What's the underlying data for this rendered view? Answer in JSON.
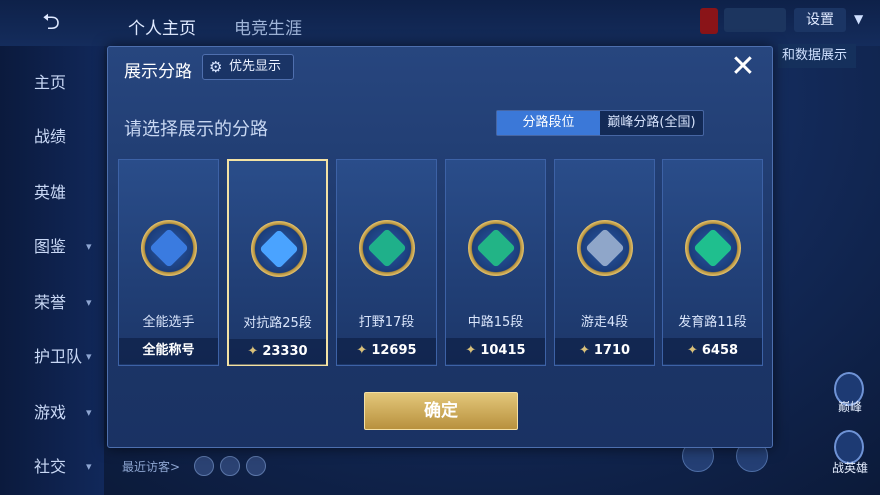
{
  "header": {
    "tabs": [
      "个人主页",
      "电竞生涯"
    ],
    "settings_label": "设置",
    "right_label": "和数据展示"
  },
  "sidebar": {
    "items": [
      {
        "label": "主页",
        "has_arrow": false
      },
      {
        "label": "战绩",
        "has_arrow": false
      },
      {
        "label": "英雄",
        "has_arrow": false
      },
      {
        "label": "图鉴",
        "has_arrow": true
      },
      {
        "label": "荣誉",
        "has_arrow": true
      },
      {
        "label": "护卫队",
        "has_arrow": true
      },
      {
        "label": "游戏",
        "has_arrow": true
      },
      {
        "label": "社交",
        "has_arrow": true
      }
    ]
  },
  "footer": {
    "visitors_label": "最近访客>"
  },
  "side_badges": [
    {
      "label": "巅峰"
    },
    {
      "label": "战英雄"
    }
  ],
  "modal": {
    "title": "展示分路",
    "priority_button": "优先显示",
    "prompt": "请选择展示的分路",
    "segments": [
      {
        "label": "分路段位",
        "active": true
      },
      {
        "label": "巅峰分路(全国)",
        "active": false
      }
    ],
    "cards": [
      {
        "lane": "全能选手",
        "score": "全能称号",
        "show_star": false,
        "selected": false,
        "glyph_color": "#3a7be0"
      },
      {
        "lane": "对抗路25段",
        "score": "23330",
        "show_star": true,
        "selected": true,
        "glyph_color": "#4aa3ff"
      },
      {
        "lane": "打野17段",
        "score": "12695",
        "show_star": true,
        "selected": false,
        "glyph_color": "#1fb08a"
      },
      {
        "lane": "中路15段",
        "score": "10415",
        "show_star": true,
        "selected": false,
        "glyph_color": "#22b486"
      },
      {
        "lane": "游走4段",
        "score": "1710",
        "show_star": true,
        "selected": false,
        "glyph_color": "#8fa6c9"
      },
      {
        "lane": "发育路11段",
        "score": "6458",
        "show_star": true,
        "selected": false,
        "glyph_color": "#1fbf8e"
      }
    ],
    "confirm_label": "确定"
  }
}
